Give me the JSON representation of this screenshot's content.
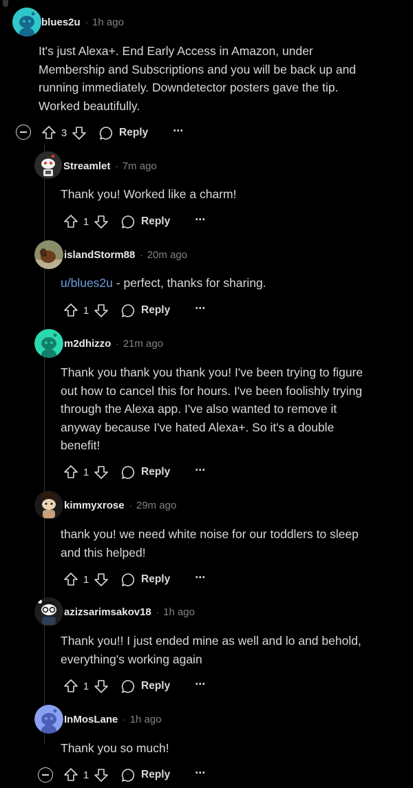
{
  "colors": {
    "background": "#000000",
    "text": "#d7dadc",
    "muted": "#818384",
    "mention": "#6f9ee0",
    "thread_line": "#343536"
  },
  "comments": [
    {
      "username": "blues2u",
      "separator": "·",
      "time": "1h ago",
      "avatar": "teal-snoo-avatar",
      "body_lines": [
        "It's just Alexa+. End Early Access in Amazon, under",
        "Membership and Subscriptions and you will be back up and",
        "running immediately. Downdetector posters gave the tip.",
        "Worked beautifully."
      ],
      "votes": "3",
      "reply_label": "Reply",
      "more_label": "···"
    },
    {
      "username": "Streamlet",
      "separator": "·",
      "time": "7m ago",
      "avatar": "snoo-robot-avatar",
      "body_lines": [
        "Thank you! Worked like a charm!"
      ],
      "votes": "1",
      "reply_label": "Reply",
      "more_label": "···"
    },
    {
      "username": "islandStorm88",
      "separator": "·",
      "time": "20m ago",
      "avatar": "dog-photo-avatar",
      "mention": "u/blues2u",
      "body_rest": " - perfect, thanks for sharing.",
      "votes": "1",
      "reply_label": "Reply",
      "more_label": "···"
    },
    {
      "username": "m2dhizzo",
      "separator": "·",
      "time": "21m ago",
      "avatar": "green-snoo-avatar",
      "body_lines": [
        "Thank you thank you thank you! I've been trying to figure",
        "out how to cancel this for hours. I've been foolishly trying",
        "through the Alexa app. I've also wanted to remove it",
        "anyway because I've hated Alexa+. So it's a double",
        "benefit!"
      ],
      "votes": "1",
      "reply_label": "Reply",
      "more_label": "···"
    },
    {
      "username": "kimmyxrose",
      "separator": "·",
      "time": "29m ago",
      "avatar": "curly-hair-snoo-avatar",
      "body_lines": [
        "thank you! we need white noise for our toddlers to sleep",
        "and this helped!"
      ],
      "votes": "1",
      "reply_label": "Reply",
      "more_label": "···"
    },
    {
      "username": "azizsarimsakov18",
      "separator": "·",
      "time": "1h ago",
      "avatar": "glasses-snoo-avatar",
      "body_lines": [
        "Thank you!! I just ended mine as well and lo and behold,",
        "everything's working again"
      ],
      "votes": "1",
      "reply_label": "Reply",
      "more_label": "···"
    },
    {
      "username": "InMosLane",
      "separator": "·",
      "time": "1h ago",
      "avatar": "blue-snoo-avatar",
      "body_lines": [
        "Thank you so much!"
      ],
      "votes": "1",
      "reply_label": "Reply",
      "more_label": "···"
    }
  ]
}
